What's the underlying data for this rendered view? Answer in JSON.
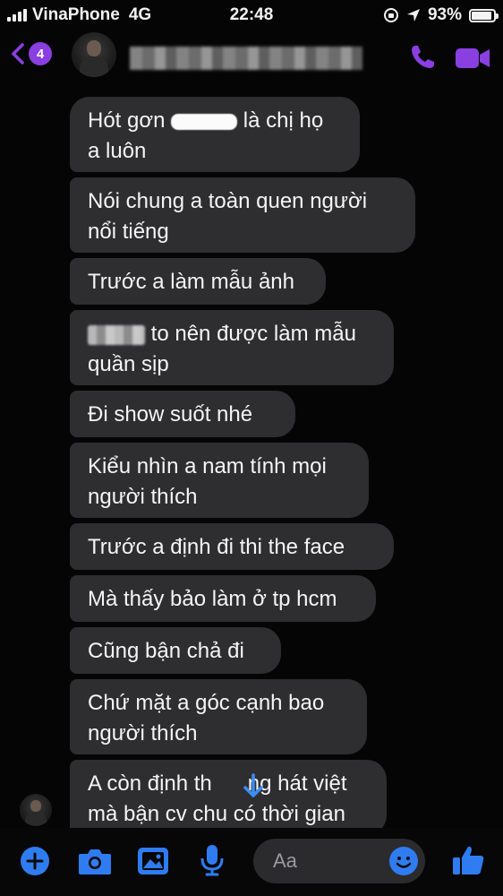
{
  "status_bar": {
    "carrier": "VinaPhone",
    "network": "4G",
    "time": "22:48",
    "battery": "93%",
    "battery_level": 0.93
  },
  "header": {
    "unread_count": "4",
    "accent_color": "#8a3fe0"
  },
  "messages": [
    {
      "lines": [
        "Hót gơn",
        "là chị họ"
      ],
      "line2": "a luôn",
      "redacted": true
    },
    {
      "line1": "Nói chung a toàn quen người",
      "line2": "nổi tiếng"
    },
    {
      "line1": "Trước a làm mẫu ảnh"
    },
    {
      "line1": "to nên được làm mẫu",
      "line2": "quần sịp",
      "redacted": true
    },
    {
      "line1": "Đi show suốt nhé"
    },
    {
      "line1": "Kiểu nhìn a nam tính mọi",
      "line2": "người thích"
    },
    {
      "line1": "Trước a định đi thi the face"
    },
    {
      "line1": "Mà thấy bảo làm ở tp hcm"
    },
    {
      "line1": "Cũng bận chả đi"
    },
    {
      "line1": "Chứ mặt a góc cạnh bao",
      "line2": "người thích"
    },
    {
      "line1a": "A còn định th",
      "line1b": "ng hát việt",
      "line2a": "mà bận cv chu",
      "line2b": "có thời gian"
    }
  ],
  "composer": {
    "placeholder": "Aa"
  },
  "icons": [
    "back-chevron-icon",
    "phone-icon",
    "video-camera-icon",
    "plus-icon",
    "camera-icon",
    "image-icon",
    "microphone-icon",
    "emoji-icon",
    "thumbs-up-icon",
    "arrow-down-icon"
  ]
}
